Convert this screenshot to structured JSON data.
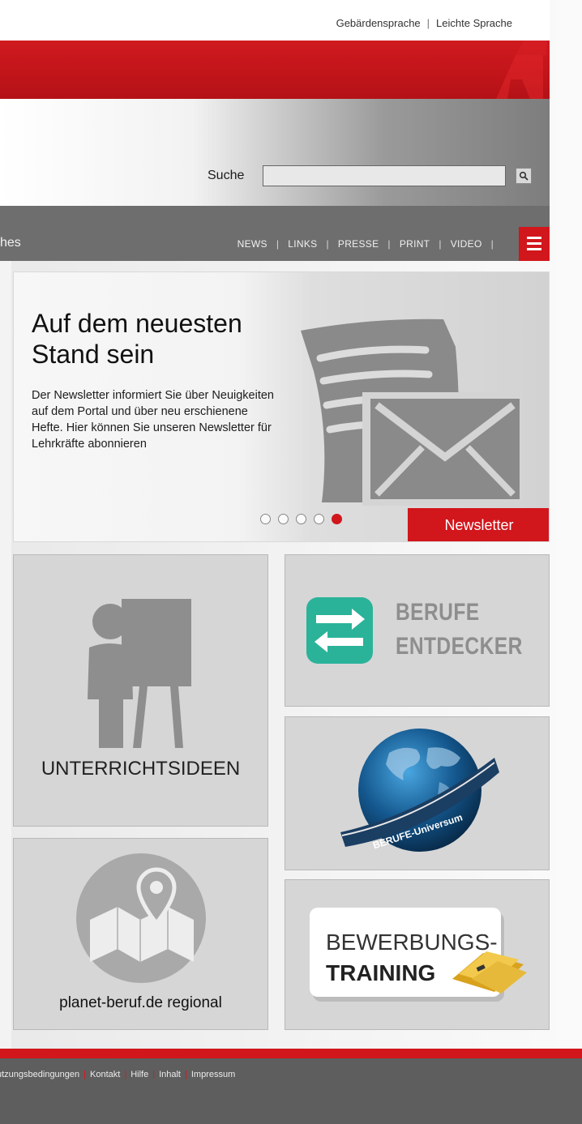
{
  "header": {
    "top_links": [
      "Gebärdensprache",
      "Leichte Sprache"
    ],
    "top_link_separator": "|",
    "search_label": "Suche",
    "search_value": ""
  },
  "nav": {
    "left_fragment": "hes",
    "links": [
      "NEWS",
      "LINKS",
      "PRESSE",
      "PRINT",
      "VIDEO"
    ],
    "separator": "|",
    "menu_icon": "hamburger-menu-icon"
  },
  "hero": {
    "title": "Auf dem neuesten Stand sein",
    "text": "Der Newsletter informiert Sie über Neuigkeiten auf dem Portal und über neu erschienene Hefte. Hier können Sie unseren Newsletter für Lehrkräfte abonnieren",
    "button_label": "Newsletter",
    "slide_count": 5,
    "active_slide": 5
  },
  "tiles": {
    "unterricht": {
      "label": "UNTERRICHTSIDEEN",
      "icon": "presenter-icon"
    },
    "regional": {
      "label": "planet-beruf.de regional",
      "icon": "map-pin-icon"
    },
    "entdecker": {
      "line1": "BERUFE",
      "line2": "ENTDECKER",
      "icon": "arrows-exchange-icon"
    },
    "universum": {
      "label": "BERUFE-Universum",
      "icon": "globe-icon"
    },
    "training": {
      "line1": "BEWERBUNGS-",
      "line2": "TRAINING",
      "icon": "folder-icon"
    }
  },
  "footer": {
    "links": [
      "utzungsbedingungen",
      "Kontakt",
      "Hilfe",
      "Inhalt",
      "Impressum"
    ],
    "separator": "|"
  },
  "colors": {
    "brand_red": "#d1161c",
    "nav_grey": "#6e6e6e",
    "tile_grey": "#d6d6d6",
    "icon_grey": "#8e8e8e",
    "teal": "#2bb39a"
  }
}
